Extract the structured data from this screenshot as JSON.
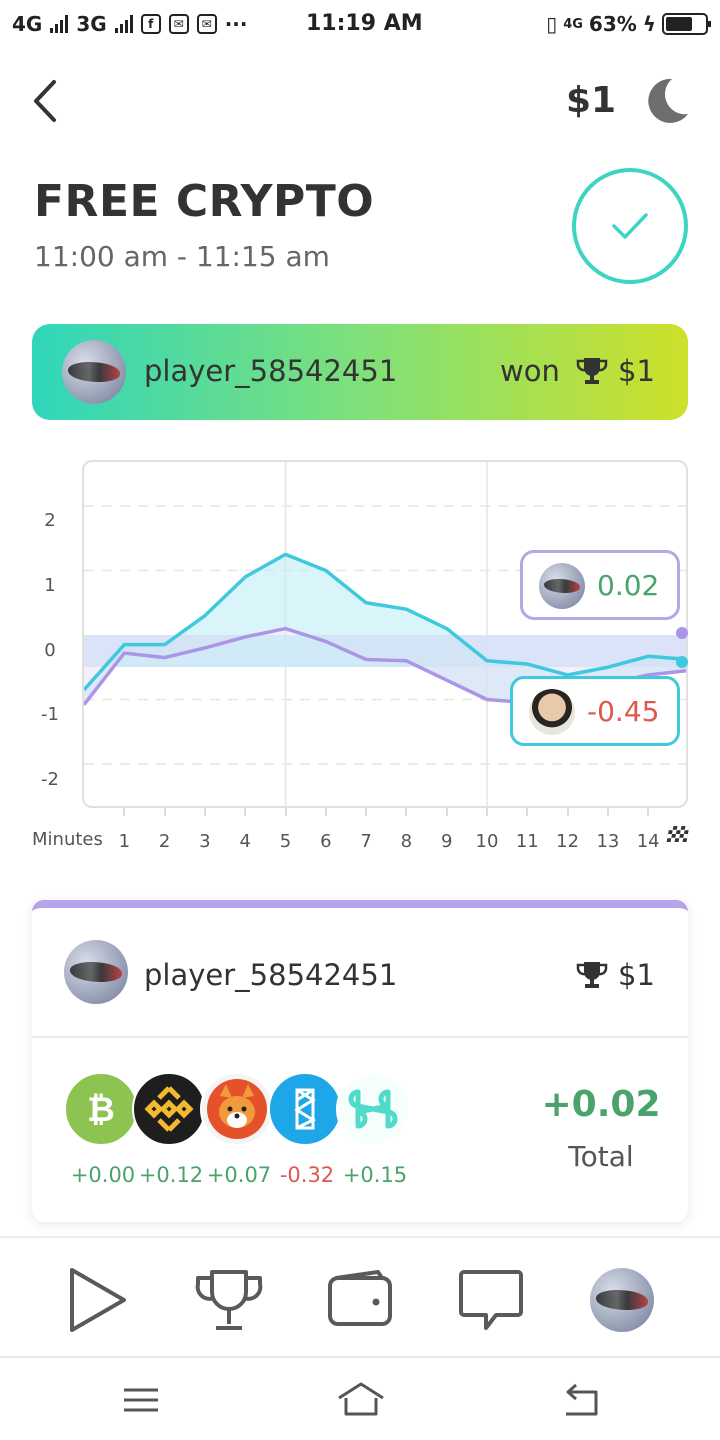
{
  "status_bar": {
    "network_left": "4G",
    "network_right": "3G",
    "more": "···",
    "time": "11:19 AM",
    "lte": "4G",
    "battery": "63%"
  },
  "header": {
    "back_icon": "chevron-left-icon",
    "balance": "$1",
    "theme_icon": "moon-icon"
  },
  "contest": {
    "title": "FREE CRYPTO",
    "time_range": "11:00 am - 11:15 am",
    "status_icon": "check-icon"
  },
  "winner_banner": {
    "player": "player_58542451",
    "won_label": "won",
    "prize": "$1"
  },
  "chart_data": {
    "type": "line",
    "xlabel": "Minutes",
    "x": [
      0,
      1,
      2,
      3,
      4,
      5,
      6,
      7,
      8,
      9,
      10,
      11,
      12,
      13,
      14,
      15
    ],
    "x_tick_labels": [
      "1",
      "2",
      "3",
      "4",
      "5",
      "6",
      "7",
      "8",
      "9",
      "10",
      "11",
      "12",
      "13",
      "14"
    ],
    "ylim": [
      -2.5,
      2.5
    ],
    "y_ticks": [
      "2",
      "1",
      "0",
      "-1",
      "-2"
    ],
    "grid": true,
    "series": [
      {
        "values": [
          -0.85,
          -0.15,
          -0.15,
          0.3,
          0.9,
          1.25,
          1.0,
          0.5,
          0.4,
          0.1,
          -0.4,
          -0.45,
          -0.62,
          -0.5,
          -0.33,
          -0.38
        ],
        "color": "#3fc8de"
      },
      {
        "values": [
          -1.08,
          -0.28,
          -0.35,
          -0.2,
          -0.03,
          0.1,
          -0.1,
          -0.38,
          -0.4,
          -0.7,
          -1.0,
          -1.05,
          -0.82,
          -0.75,
          -0.62,
          -0.55
        ],
        "color": "#ab95e6"
      }
    ],
    "callouts": [
      {
        "value": "0.02",
        "color": "#4aa36a",
        "border": "#b6a7e4"
      },
      {
        "value": "-0.45",
        "color": "#e0574f",
        "border": "#41c8df"
      }
    ]
  },
  "player_card": {
    "player": "player_58542451",
    "prize": "$1",
    "coins": [
      {
        "icon": "bitcoin-cash-icon",
        "change": "+0.00",
        "positive": true
      },
      {
        "icon": "binance-coin-icon",
        "change": "+0.12",
        "positive": true
      },
      {
        "icon": "shiba-inu-icon",
        "change": "+0.07",
        "positive": true
      },
      {
        "icon": "fantom-icon",
        "change": "-0.32",
        "positive": false
      },
      {
        "icon": "harmony-icon",
        "change": "+0.15",
        "positive": true
      }
    ],
    "total_value": "+0.02",
    "total_label": "Total"
  },
  "bottom_nav": [
    "play-icon",
    "trophy-icon",
    "wallet-icon",
    "chat-icon",
    "profile-avatar"
  ],
  "system_nav": [
    "menu-icon",
    "home-icon",
    "back-icon"
  ],
  "colors": {
    "accent_teal": "#3ed4c4",
    "positive": "#4aa36a",
    "negative": "#e0574f",
    "purple": "#b5a4ea"
  }
}
